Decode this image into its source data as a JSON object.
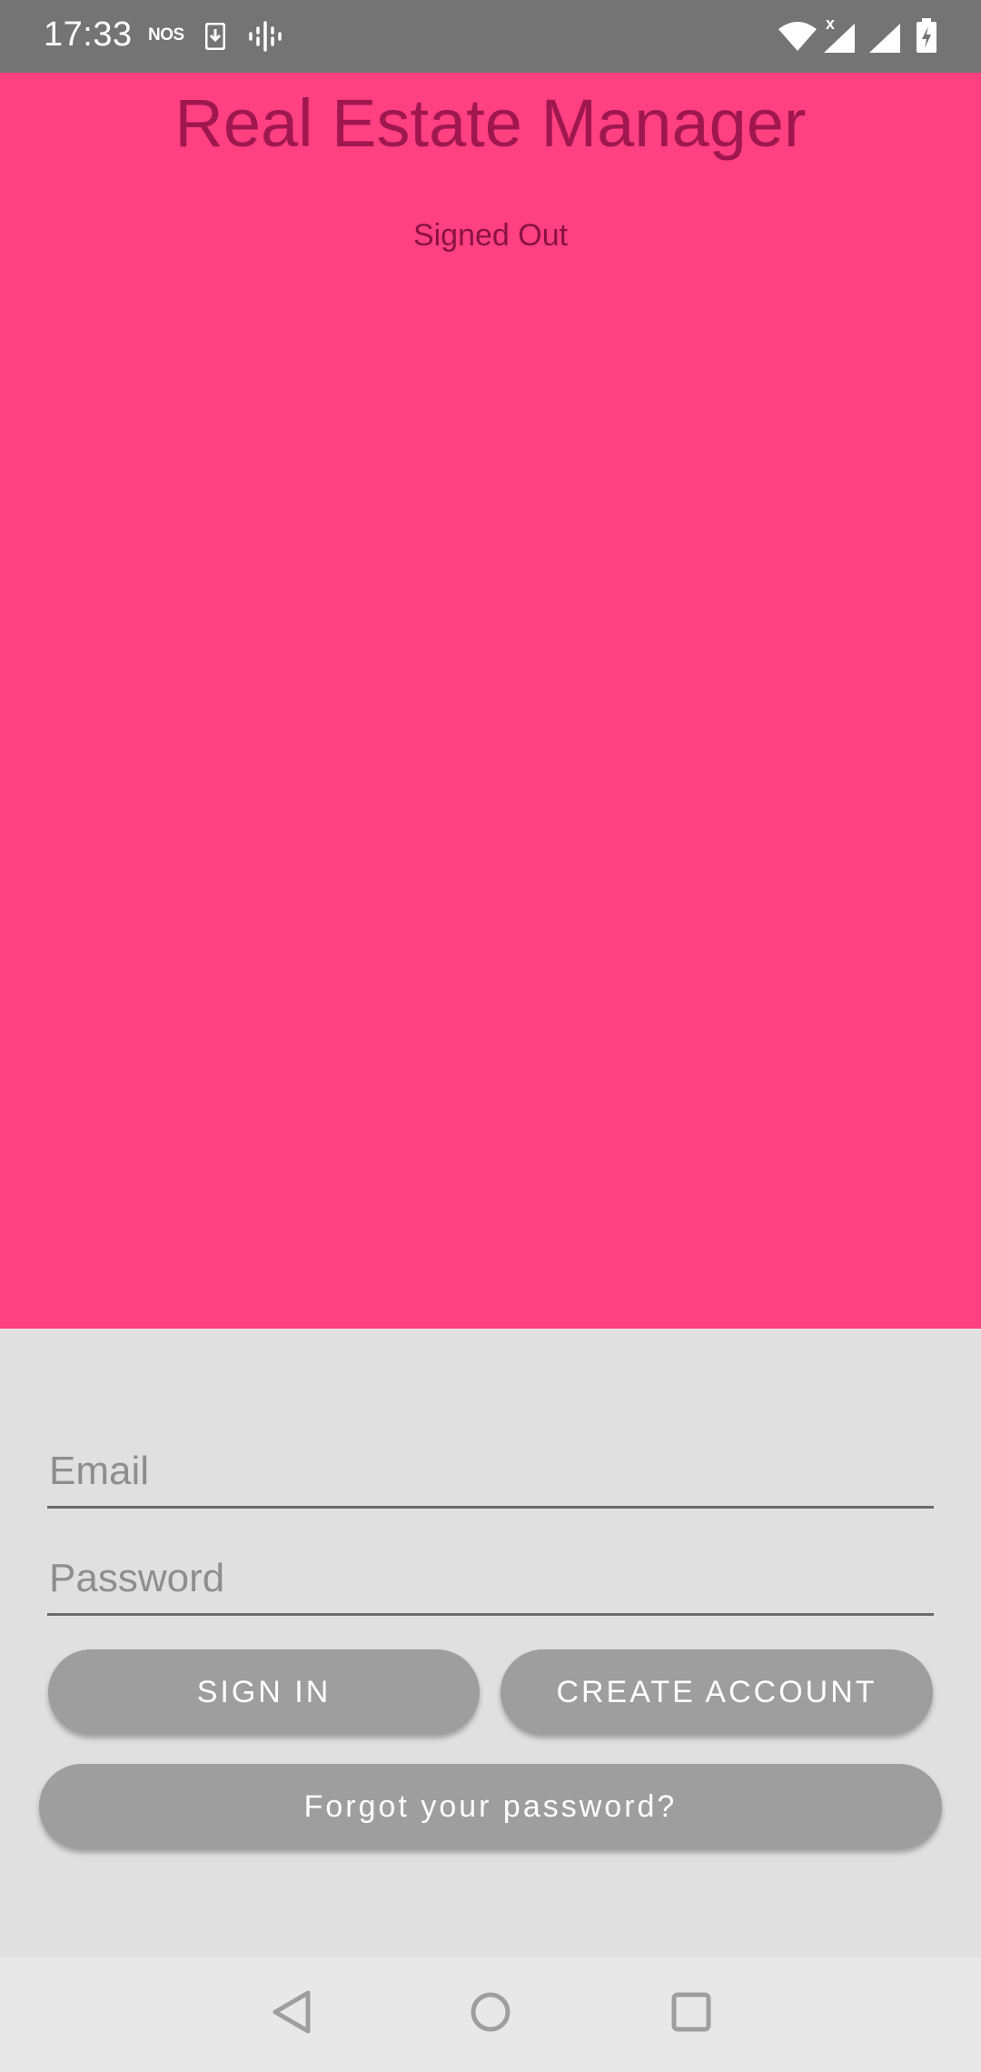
{
  "status_bar": {
    "time": "17:33",
    "carrier": "NOS"
  },
  "header": {
    "title": "Real Estate Manager",
    "status": "Signed Out"
  },
  "form": {
    "email_placeholder": "Email",
    "password_placeholder": "Password",
    "sign_in_label": "SIGN IN",
    "create_account_label": "CREATE ACCOUNT",
    "forgot_password_label": "Forgot your password?"
  },
  "colors": {
    "accent": "#ff4081",
    "button": "#9e9e9e",
    "form_background": "#e0e0e0",
    "status_bar": "#747474"
  },
  "icons": {
    "status_bar": [
      "download-icon",
      "podcast-icon",
      "wifi-icon",
      "signal-icon",
      "signal-icon",
      "battery-charging-icon"
    ],
    "navigation": [
      "back-icon",
      "home-icon",
      "recents-icon"
    ]
  }
}
